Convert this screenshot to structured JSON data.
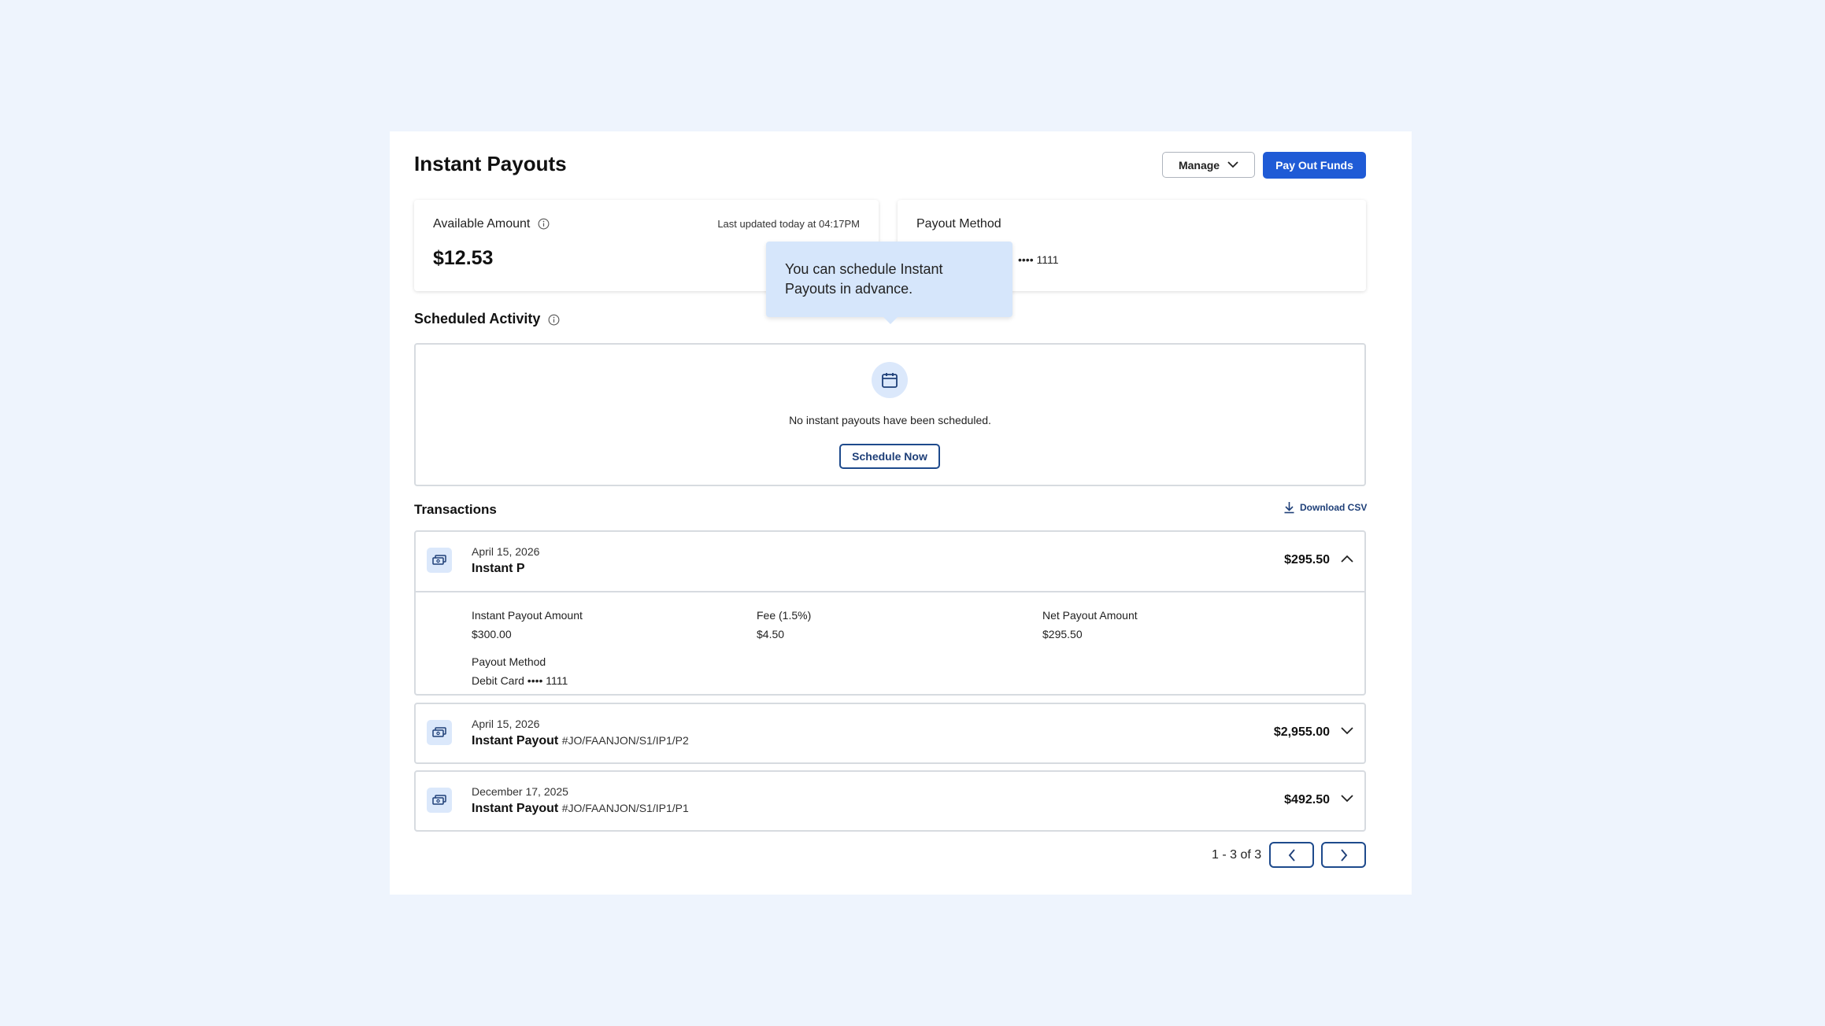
{
  "header": {
    "title": "Instant Payouts",
    "manage_label": "Manage",
    "pay_out_label": "Pay Out Funds"
  },
  "available": {
    "label": "Available Amount",
    "amount": "$12.53",
    "updated": "Last updated today at 04:17PM"
  },
  "payout_method": {
    "label": "Payout Method",
    "masked": "•••• 1111"
  },
  "tooltip": {
    "text": "You can schedule Instant Payouts in advance."
  },
  "scheduled": {
    "title": "Scheduled Activity",
    "empty_text": "No instant payouts have been scheduled.",
    "schedule_label": "Schedule Now"
  },
  "transactions": {
    "title": "Transactions",
    "download_label": "Download CSV",
    "items": [
      {
        "date": "April 15, 2026",
        "name": "Instant P",
        "id": "",
        "amount": "$295.50",
        "expanded": true,
        "details": {
          "amount_label": "Instant Payout Amount",
          "amount_value": "$300.00",
          "fee_label": "Fee (1.5%)",
          "fee_value": "$4.50",
          "net_label": "Net Payout Amount",
          "net_value": "$295.50",
          "method_label": "Payout Method",
          "method_value": "Debit Card •••• 1111"
        }
      },
      {
        "date": "April 15, 2026",
        "name": "Instant Payout",
        "id": "#JO/FAANJON/S1/IP1/P2",
        "amount": "$2,955.00",
        "expanded": false
      },
      {
        "date": "December 17, 2025",
        "name": "Instant Payout",
        "id": "#JO/FAANJON/S1/IP1/P1",
        "amount": "$492.50",
        "expanded": false
      }
    ]
  },
  "pagination": {
    "text": "1 - 3 of 3"
  },
  "colors": {
    "background": "#eef4fd",
    "primary": "#1f5bd6",
    "accent_dark": "#1e3f78",
    "tooltip": "#d6e6fb"
  }
}
